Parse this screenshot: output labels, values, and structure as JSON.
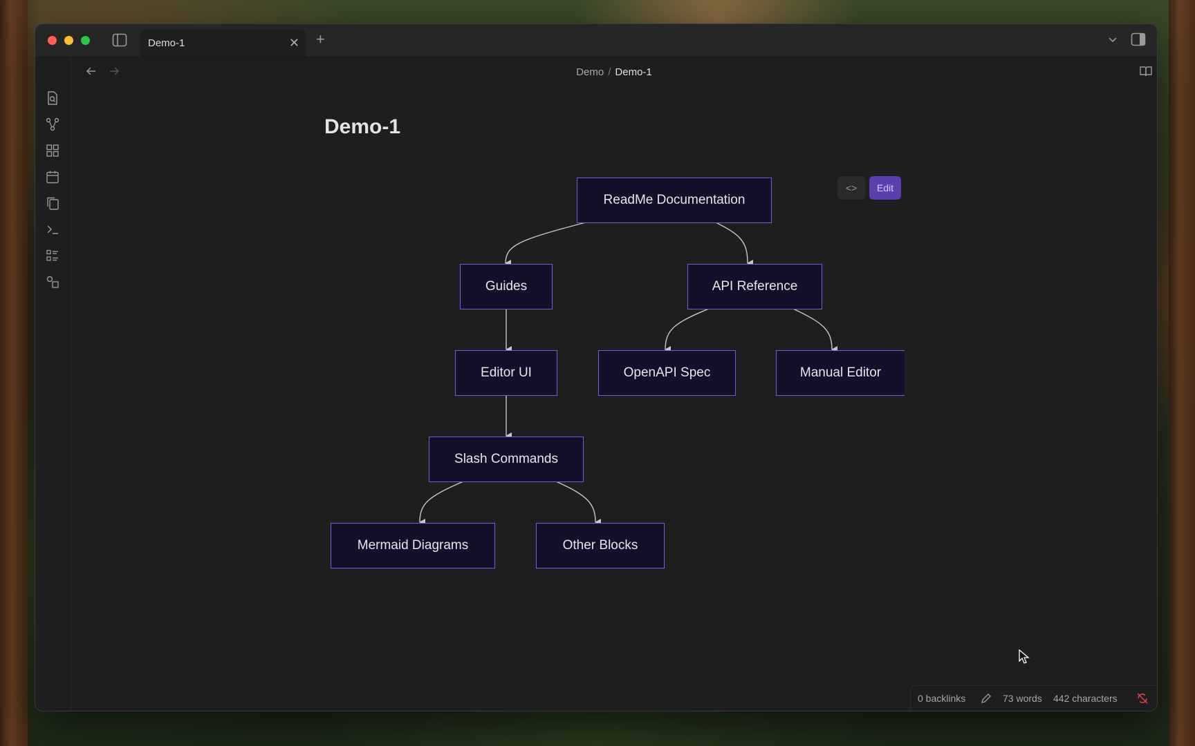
{
  "tab": {
    "title": "Demo-1",
    "close_glyph": "✕",
    "new_tab_glyph": "+"
  },
  "breadcrumb": {
    "parent": "Demo",
    "separator": "/",
    "current": "Demo-1"
  },
  "note": {
    "title": "Demo-1"
  },
  "diagram_toolbar": {
    "code_label": "<>",
    "edit_label": "Edit"
  },
  "diagram": {
    "nodes": {
      "root": "ReadMe Documentation",
      "guides": "Guides",
      "api": "API Reference",
      "editor_ui": "Editor UI",
      "openapi": "OpenAPI Spec",
      "manual": "Manual Editor",
      "slash": "Slash Commands",
      "mermaid": "Mermaid Diagrams",
      "other": "Other Blocks"
    },
    "colors": {
      "node_fill": "#13112a",
      "node_stroke": "#7a5ad6",
      "edge": "#c8c8c8"
    }
  },
  "status_bar": {
    "backlinks": "0 backlinks",
    "words": "73 words",
    "characters": "442 characters"
  },
  "icons": {
    "ribbon": [
      "file-search-icon",
      "graph-icon",
      "grid-icon",
      "calendar-icon",
      "copy-icon",
      "terminal-icon",
      "list-icon",
      "shapes-icon"
    ],
    "titlebar": [
      "sidebar-toggle-icon",
      "chevron-down-icon",
      "right-sidebar-icon"
    ],
    "nav": [
      "back-arrow-icon",
      "forward-arrow-icon",
      "reading-mode-icon",
      "more-options-icon"
    ]
  },
  "accent": "#5a3fb0"
}
